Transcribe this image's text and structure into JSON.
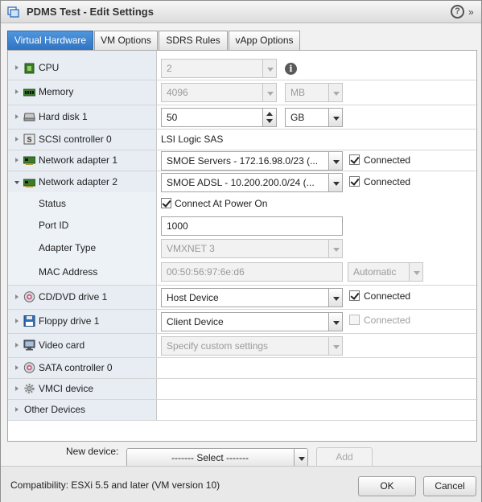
{
  "window": {
    "title": "PDMS Test - Edit Settings"
  },
  "tabs": [
    {
      "label": "Virtual Hardware",
      "active": true
    },
    {
      "label": "VM Options"
    },
    {
      "label": "SDRS Rules"
    },
    {
      "label": "vApp Options"
    }
  ],
  "hardware": {
    "cpu": {
      "label": "CPU",
      "value": "2"
    },
    "memory": {
      "label": "Memory",
      "value": "4096",
      "unit": "MB"
    },
    "hard_disk": {
      "label": "Hard disk 1",
      "value": "50",
      "unit": "GB"
    },
    "scsi": {
      "label": "SCSI controller 0",
      "value": "LSI Logic SAS"
    },
    "net1": {
      "label": "Network adapter 1",
      "value": "SMOE Servers - 172.16.98.0/23 (...",
      "connected_label": "Connected",
      "connected": true
    },
    "net2": {
      "label": "Network adapter 2",
      "value": "SMOE ADSL - 10.200.200.0/24 (...",
      "connected_label": "Connected",
      "connected": true,
      "status_label": "Status",
      "status_value": "Connect At Power On",
      "port_label": "Port ID",
      "port_value": "1000",
      "adapter_type_label": "Adapter Type",
      "adapter_type_value": "VMXNET 3",
      "mac_label": "MAC Address",
      "mac_value": "00:50:56:97:6e:d6",
      "mac_mode": "Automatic"
    },
    "cddvd": {
      "label": "CD/DVD drive 1",
      "value": "Host Device",
      "connected_label": "Connected",
      "connected": true
    },
    "floppy": {
      "label": "Floppy drive 1",
      "value": "Client Device",
      "connected_label": "Connected",
      "connected": false
    },
    "video": {
      "label": "Video card",
      "value": "Specify custom settings"
    },
    "sata": {
      "label": "SATA controller 0"
    },
    "vmci": {
      "label": "VMCI device"
    },
    "other": {
      "label": "Other Devices"
    }
  },
  "new_device": {
    "label": "New device:",
    "select_value": "------- Select -------",
    "add_label": "Add"
  },
  "footer": {
    "compatibility": "Compatibility: ESXi 5.5 and later (VM version 10)",
    "ok_label": "OK",
    "cancel_label": "Cancel"
  },
  "colors": {
    "tab_active": "#2f74c2",
    "label_column": "#e7edf3"
  }
}
